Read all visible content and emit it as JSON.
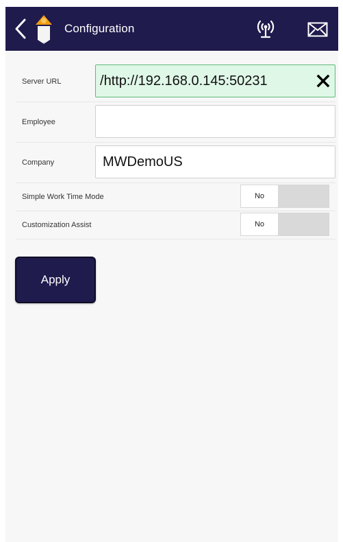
{
  "app_bar": {
    "title": "Configuration",
    "colors": {
      "background": "#1f1b4d",
      "text": "#ffffff",
      "logo_top": "#f29a13",
      "logo_body": "#f4f4f4"
    },
    "icons": {
      "back": "chevron-left-icon",
      "logo": "app-logo-icon",
      "signal": "wireless-signal-icon",
      "mail": "envelope-icon"
    }
  },
  "form": {
    "server_url": {
      "label": "Server URL",
      "value": "http://192.168.0.145:50231/",
      "focused": true,
      "clear_icon": "close-icon"
    },
    "employee": {
      "label": "Employee",
      "value": ""
    },
    "company": {
      "label": "Company",
      "value": "MWDemoUS"
    },
    "simple_work_time_mode": {
      "label": "Simple Work Time Mode",
      "value": "No"
    },
    "customization_assist": {
      "label": "Customization Assist",
      "value": "No"
    }
  },
  "actions": {
    "apply_label": "Apply"
  },
  "colors": {
    "page_background": "#f7f7f7",
    "focused_field_background": "#dff7e7",
    "focused_field_border": "#5fb87d",
    "toggle_track": "#d9d9d9"
  }
}
